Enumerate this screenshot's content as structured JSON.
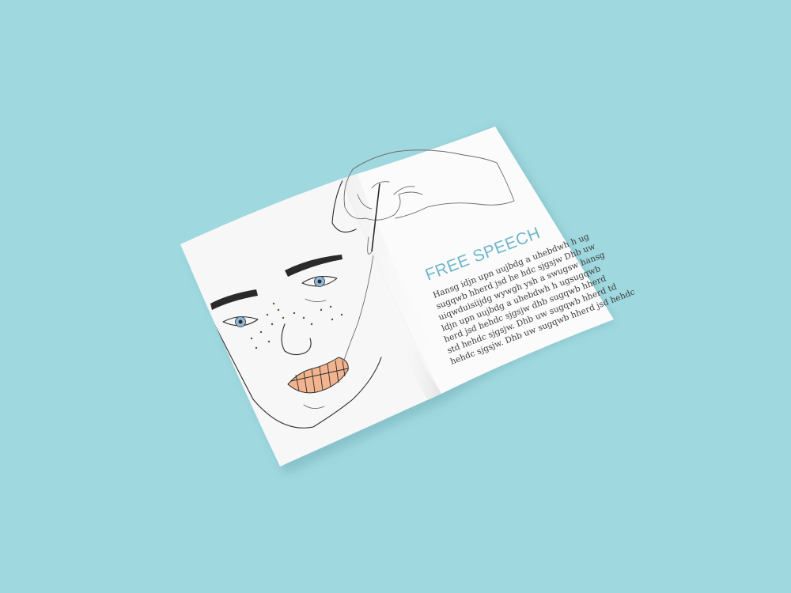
{
  "background_color": "#9fd8df",
  "magazine": {
    "right_page": {
      "heading": "FREE SPEECH",
      "heading_color": "#6fb6c8",
      "body_lines": [
        "Hansg idjn upn uujbdg a uhebdwh h ug",
        "sugqwb hherd jsd he hdc sjgsjw Dhb uw",
        "uiqwduisiijdg wywgh ysh a swugsw hansg",
        "ldjn upn uujbdg a uhebdwh h ugsugqwb",
        "herd jsd hehdc sjgsjw dhb sugqwb hherd",
        "std hehdc sjgsjw. Dhb uw sugqwb hherd td",
        "hehdc sjgsjw. Dhb uw sugqwb hherd jsd hehdc"
      ]
    },
    "left_page": {
      "illustration": "line-drawn-face-with-sewn-lips",
      "lip_color": "#f2b48e",
      "eye_color": "#8fb8d8"
    },
    "hand_illustration": "hand-holding-needle"
  }
}
